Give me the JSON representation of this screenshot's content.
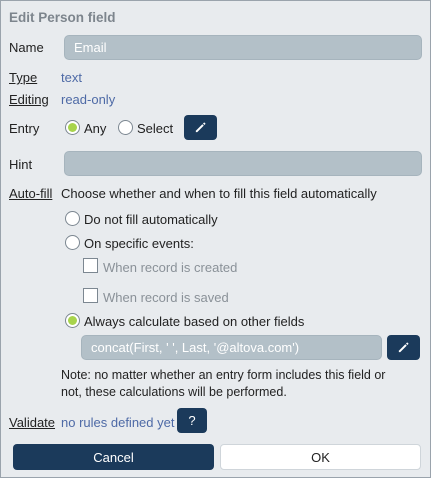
{
  "dialog": {
    "title": "Edit Person field"
  },
  "name": {
    "label": "Name",
    "value": "Email"
  },
  "type": {
    "label": "Type",
    "value": "text"
  },
  "editing": {
    "label": "Editing",
    "value": "read-only"
  },
  "entry": {
    "label": "Entry",
    "option_any": "Any",
    "option_select": "Select",
    "selected": "Any"
  },
  "hint": {
    "label": "Hint",
    "value": ""
  },
  "autofill": {
    "label": "Auto-fill",
    "description": "Choose whether and when to fill this field automatically",
    "option_none": "Do not fill automatically",
    "option_events": "On specific events:",
    "event_created": "When record is created",
    "event_saved": "When record is saved",
    "option_always": "Always calculate based on other fields",
    "selected": "Always calculate based on other fields",
    "formula": "concat(First, ' ', Last, '@altova.com')",
    "note_line1": "Note: no matter whether an entry form includes this field or",
    "note_line2": "not, these calculations will be performed."
  },
  "validate": {
    "label": "Validate",
    "value": "no rules defined yet",
    "help": "?"
  },
  "buttons": {
    "cancel": "Cancel",
    "ok": "OK"
  },
  "colors": {
    "primary": "#1b3a5b",
    "field_bg": "#b3c0c8",
    "radio_selected": "#a8d44c",
    "link": "#4e6aa6"
  }
}
